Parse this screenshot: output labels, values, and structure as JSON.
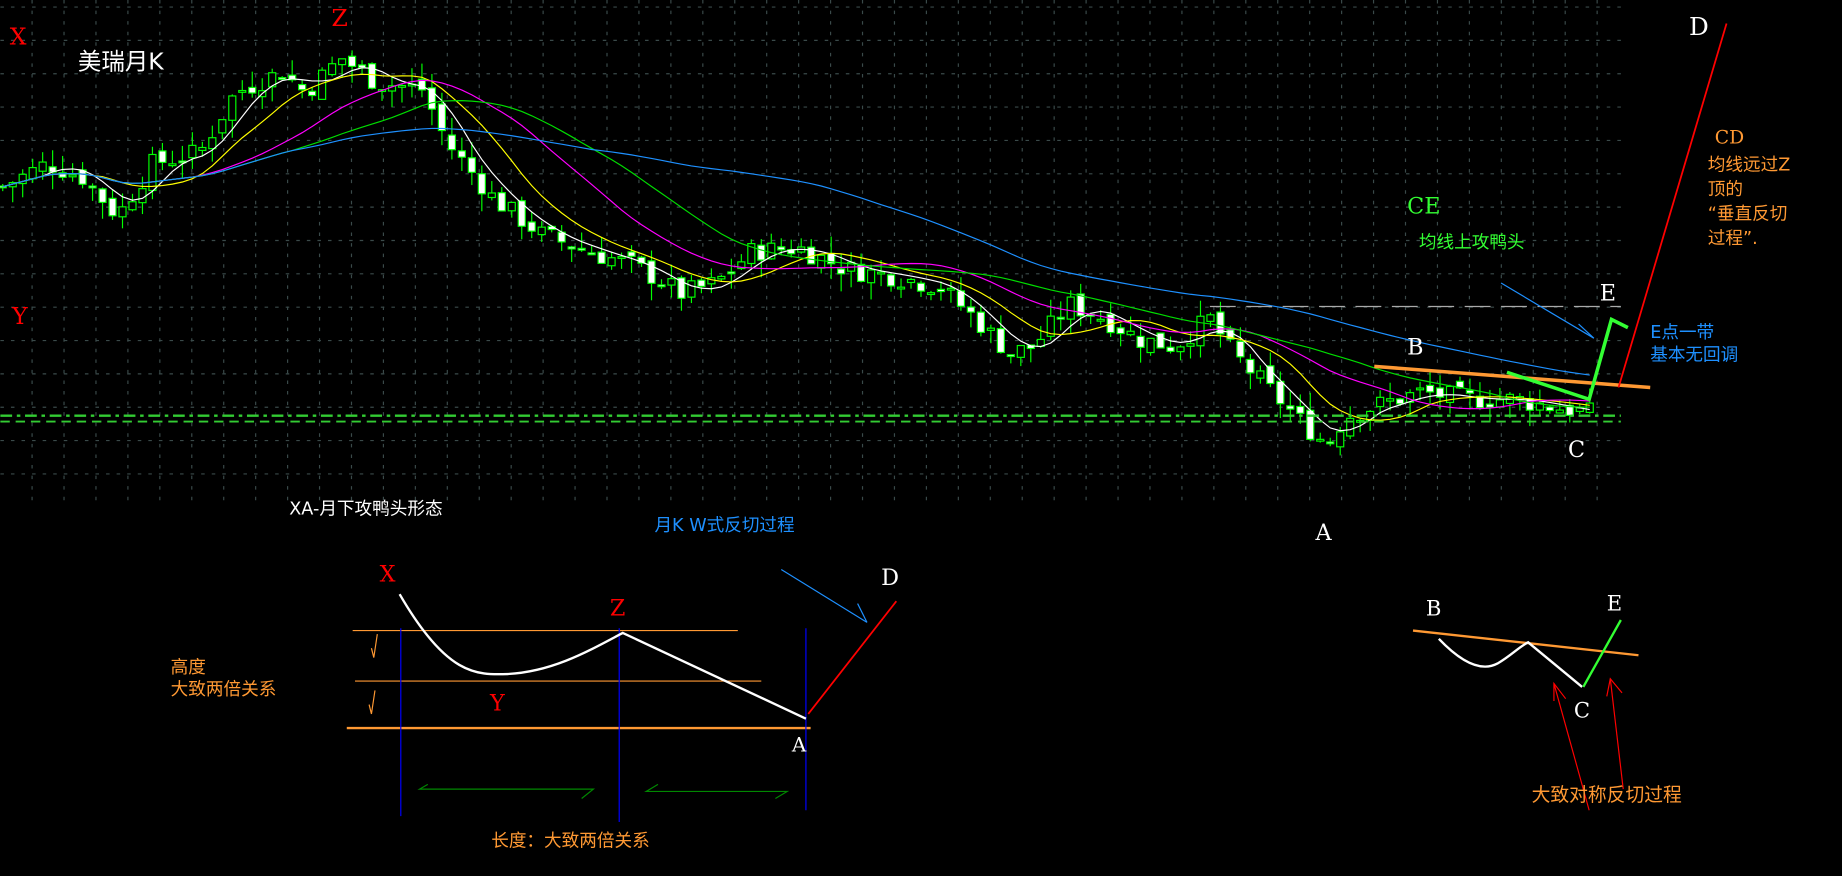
{
  "title": "美瑞月K",
  "colors": {
    "bg": "#000000",
    "candle": "#00ff00",
    "grid": "#3a4a4a",
    "ma5": "#ffffff",
    "ma10": "#ffff00",
    "ma20": "#ff00ff",
    "ma30": "#00dd00",
    "ma60": "#1e90ff",
    "orange": "#ff9933",
    "red": "#ff0000",
    "blue": "#1e90ff",
    "green": "#33ff33"
  },
  "chart_data": {
    "type": "candlestick",
    "title": "美瑞月K",
    "xlabel": "",
    "ylabel": "",
    "ylim": [
      0,
      145
    ],
    "grid": true,
    "note": "relative price index, no axis shown",
    "close_path": [
      [
        0,
        90
      ],
      [
        40,
        97
      ],
      [
        70,
        93
      ],
      [
        100,
        82
      ],
      [
        130,
        97
      ],
      [
        170,
        100
      ],
      [
        200,
        117
      ],
      [
        240,
        123
      ],
      [
        260,
        117
      ],
      [
        290,
        127
      ],
      [
        320,
        120
      ],
      [
        360,
        118
      ],
      [
        380,
        103
      ],
      [
        420,
        87
      ],
      [
        460,
        77
      ],
      [
        500,
        72
      ],
      [
        540,
        68
      ],
      [
        580,
        60
      ],
      [
        610,
        63
      ],
      [
        640,
        72
      ],
      [
        680,
        73
      ],
      [
        720,
        67
      ],
      [
        760,
        65
      ],
      [
        800,
        62
      ],
      [
        830,
        53
      ],
      [
        860,
        43
      ],
      [
        880,
        45
      ],
      [
        910,
        57
      ],
      [
        940,
        53
      ],
      [
        970,
        47
      ],
      [
        1000,
        45
      ],
      [
        1030,
        53
      ],
      [
        1050,
        43
      ],
      [
        1080,
        33
      ],
      [
        1110,
        23
      ],
      [
        1130,
        17
      ],
      [
        1145,
        25
      ],
      [
        1170,
        28
      ],
      [
        1210,
        32
      ],
      [
        1250,
        30
      ],
      [
        1290,
        30
      ],
      [
        1320,
        28
      ],
      [
        1355,
        26
      ]
    ],
    "moving_averages": [
      "MA5",
      "MA10",
      "MA20",
      "MA30",
      "MA60"
    ]
  },
  "labels": {
    "X": "X",
    "Y": "Y",
    "Z": "Z",
    "A": "A",
    "B": "B",
    "C": "C",
    "D": "D",
    "E": "E",
    "ce": "CE",
    "ce_desc": "均线上攻鸭头",
    "cd": "CD",
    "cd_desc": [
      "均线远过Z",
      "顶的",
      "“垂直反切",
      "过程”."
    ],
    "e_desc": [
      "E点一带",
      "基本无回调"
    ],
    "xa_pattern": "XA-月下攻鸭头形态",
    "w_process": "月K   W式反切过程",
    "height_label": [
      "高度",
      "大致两倍关系"
    ],
    "length_label": "长度：大致两倍关系",
    "symmetric_label": "大致对称反切过程"
  }
}
